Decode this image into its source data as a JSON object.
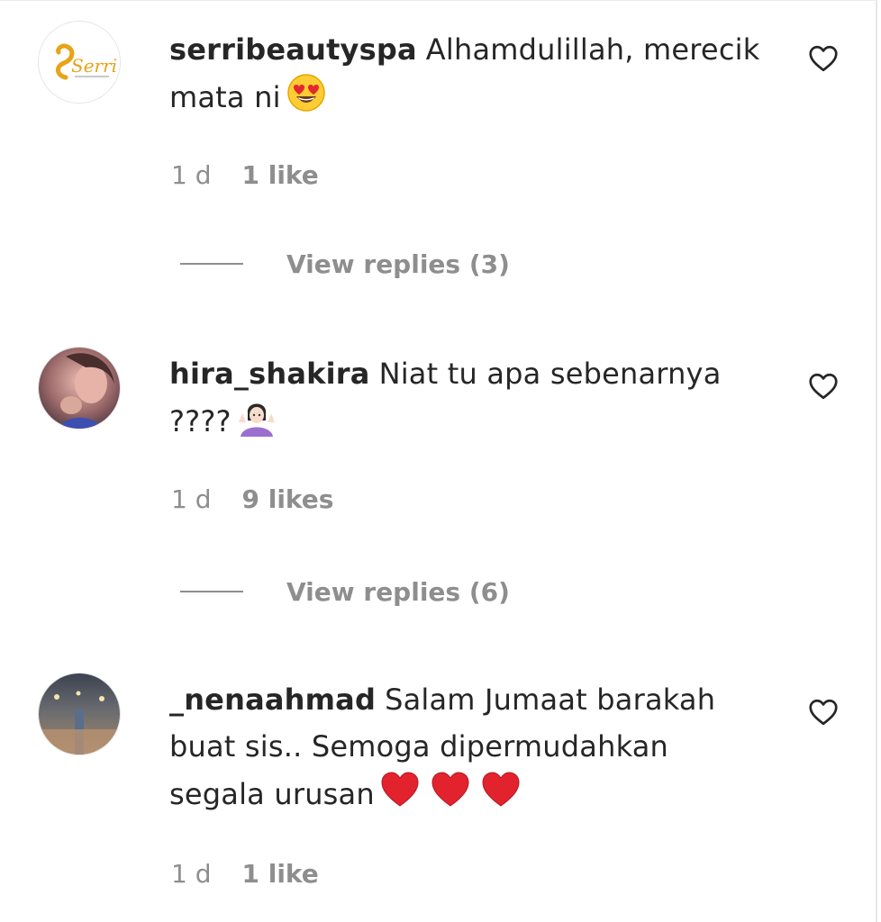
{
  "comments": [
    {
      "username": "serribeautyspa",
      "text": "Alhamdulillah, merecik mata ni",
      "emoji": "heart-eyes-emoji",
      "avatar": "serri-logo",
      "avatar_text": "Serri",
      "time": "1 d",
      "likes": "1 like",
      "replies": "View replies (3)"
    },
    {
      "username": "hira_shakira",
      "text": "Niat tu apa sebenarnya ????",
      "emoji": "person-shrugging-emoji",
      "avatar": "profile-photo",
      "time": "1 d",
      "likes": "9 likes",
      "replies": "View replies (6)"
    },
    {
      "username": "_nenaahmad",
      "text": "Salam Jumaat barakah buat sis.. Semoga dipermudahkan segala urusan",
      "emoji": "red-heart-emoji",
      "avatar": "profile-photo",
      "time": "1 d",
      "likes": "1 like"
    }
  ],
  "icons": {
    "like": "heart-outline-icon"
  },
  "colors": {
    "text": "#262626",
    "muted": "#8e8e8e",
    "heart_red": "#ed4956",
    "serri_gold": "#e8a317"
  }
}
